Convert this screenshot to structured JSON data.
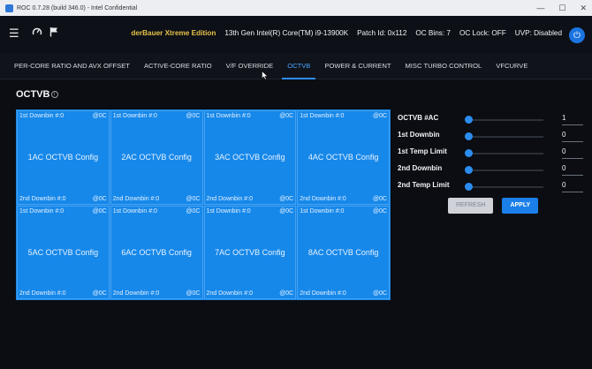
{
  "window": {
    "title": "ROC 0.7.28 (build 346.0) - Intel Confidential",
    "controls": [
      "—",
      "☐",
      "✕"
    ]
  },
  "header": {
    "brand": "derBauer Xtreme Edition",
    "cpu": "13th Gen Intel(R) Core(TM) i9-13900K",
    "patch_id": "Patch Id: 0x112",
    "oc_bins": "OC Bins: 7",
    "oc_lock": "OC Lock: OFF",
    "uvp": "UVP: Disabled",
    "icons": {
      "menu": "hamburger-icon",
      "gauge": "gauge-icon",
      "flag": "flag-icon",
      "power": "power-icon"
    }
  },
  "tabs": [
    {
      "label": "PER-CORE RATIO AND AVX OFFSET",
      "active": false
    },
    {
      "label": "ACTIVE-CORE RATIO",
      "active": false
    },
    {
      "label": "V/F OVERRIDE",
      "active": false
    },
    {
      "label": "OCTVB",
      "active": true
    },
    {
      "label": "POWER & CURRENT",
      "active": false
    },
    {
      "label": "MISC TURBO CONTROL",
      "active": false
    },
    {
      "label": "VFCURVE",
      "active": false
    }
  ],
  "section": {
    "title": "OCTVB",
    "info_icon": "info-icon"
  },
  "cells": [
    {
      "title": "1AC OCTVB Config",
      "top_left": "1st Downbin #:0",
      "top_right": "@0C",
      "bottom_left": "2nd Downbin #:0",
      "bottom_right": "@0C"
    },
    {
      "title": "2AC OCTVB Config",
      "top_left": "1st Downbin #:0",
      "top_right": "@0C",
      "bottom_left": "2nd Downbin #:0",
      "bottom_right": "@0C"
    },
    {
      "title": "3AC OCTVB Config",
      "top_left": "1st Downbin #:0",
      "top_right": "@0C",
      "bottom_left": "2nd Downbin #:0",
      "bottom_right": "@0C"
    },
    {
      "title": "4AC OCTVB Config",
      "top_left": "1st Downbin #:0",
      "top_right": "@0C",
      "bottom_left": "2nd Downbin #:0",
      "bottom_right": "@0C"
    },
    {
      "title": "5AC OCTVB Config",
      "top_left": "1st Downbin #:0",
      "top_right": "@0C",
      "bottom_left": "2nd Downbin #:0",
      "bottom_right": "@0C"
    },
    {
      "title": "6AC OCTVB Config",
      "top_left": "1st Downbin #:0",
      "top_right": "@0C",
      "bottom_left": "2nd Downbin #:0",
      "bottom_right": "@0C"
    },
    {
      "title": "7AC OCTVB Config",
      "top_left": "1st Downbin #:0",
      "top_right": "@0C",
      "bottom_left": "2nd Downbin #:0",
      "bottom_right": "@0C"
    },
    {
      "title": "8AC OCTVB Config",
      "top_left": "1st Downbin #:0",
      "top_right": "@0C",
      "bottom_left": "2nd Downbin #:0",
      "bottom_right": "@0C"
    }
  ],
  "settings": [
    {
      "label": "OCTVB #AC",
      "value": "1"
    },
    {
      "label": "1st Downbin",
      "value": "0"
    },
    {
      "label": "1st Temp Limit",
      "value": "0"
    },
    {
      "label": "2nd Downbin",
      "value": "0"
    },
    {
      "label": "2nd Temp Limit",
      "value": "0"
    }
  ],
  "buttons": {
    "refresh": "REFRESH",
    "apply": "APPLY"
  },
  "colors": {
    "accent": "#1b7fea",
    "brand": "#e5c24b",
    "grid": "#1688ea"
  }
}
